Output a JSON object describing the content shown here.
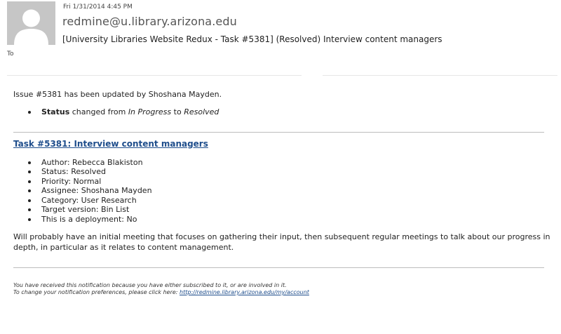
{
  "header": {
    "date": "Fri 1/31/2014 4:45 PM",
    "sender": "redmine@u.library.arizona.edu",
    "subject": "[University Libraries Website Redux - Task #5381] (Resolved) Interview content managers",
    "to_label": "To",
    "avatar_icon": "person-silhouette-icon"
  },
  "body": {
    "intro": "Issue #5381 has been updated by Shoshana Mayden.",
    "change": {
      "field": "Status",
      "text_changed_from": "changed from",
      "from": "In Progress",
      "to_word": "to",
      "to": "Resolved"
    },
    "task_title": "Task #5381: Interview content managers",
    "details": [
      "Author: Rebecca Blakiston",
      "Status: Resolved",
      "Priority: Normal",
      "Assignee: Shoshana Mayden",
      "Category: User Research",
      "Target version: Bin List",
      "This is a deployment: No"
    ],
    "description": "Will probably have an initial meeting that focuses on gathering their input, then subsequent regular meetings to talk about our progress in depth, in particular as it relates to content management."
  },
  "footer": {
    "line1": "You have received this notification because you have either subscribed to it, or are involved in it.",
    "line2_prefix": "To change your notification preferences, please click here:",
    "link": "http://redmine.library.arizona.edu/my/account"
  }
}
